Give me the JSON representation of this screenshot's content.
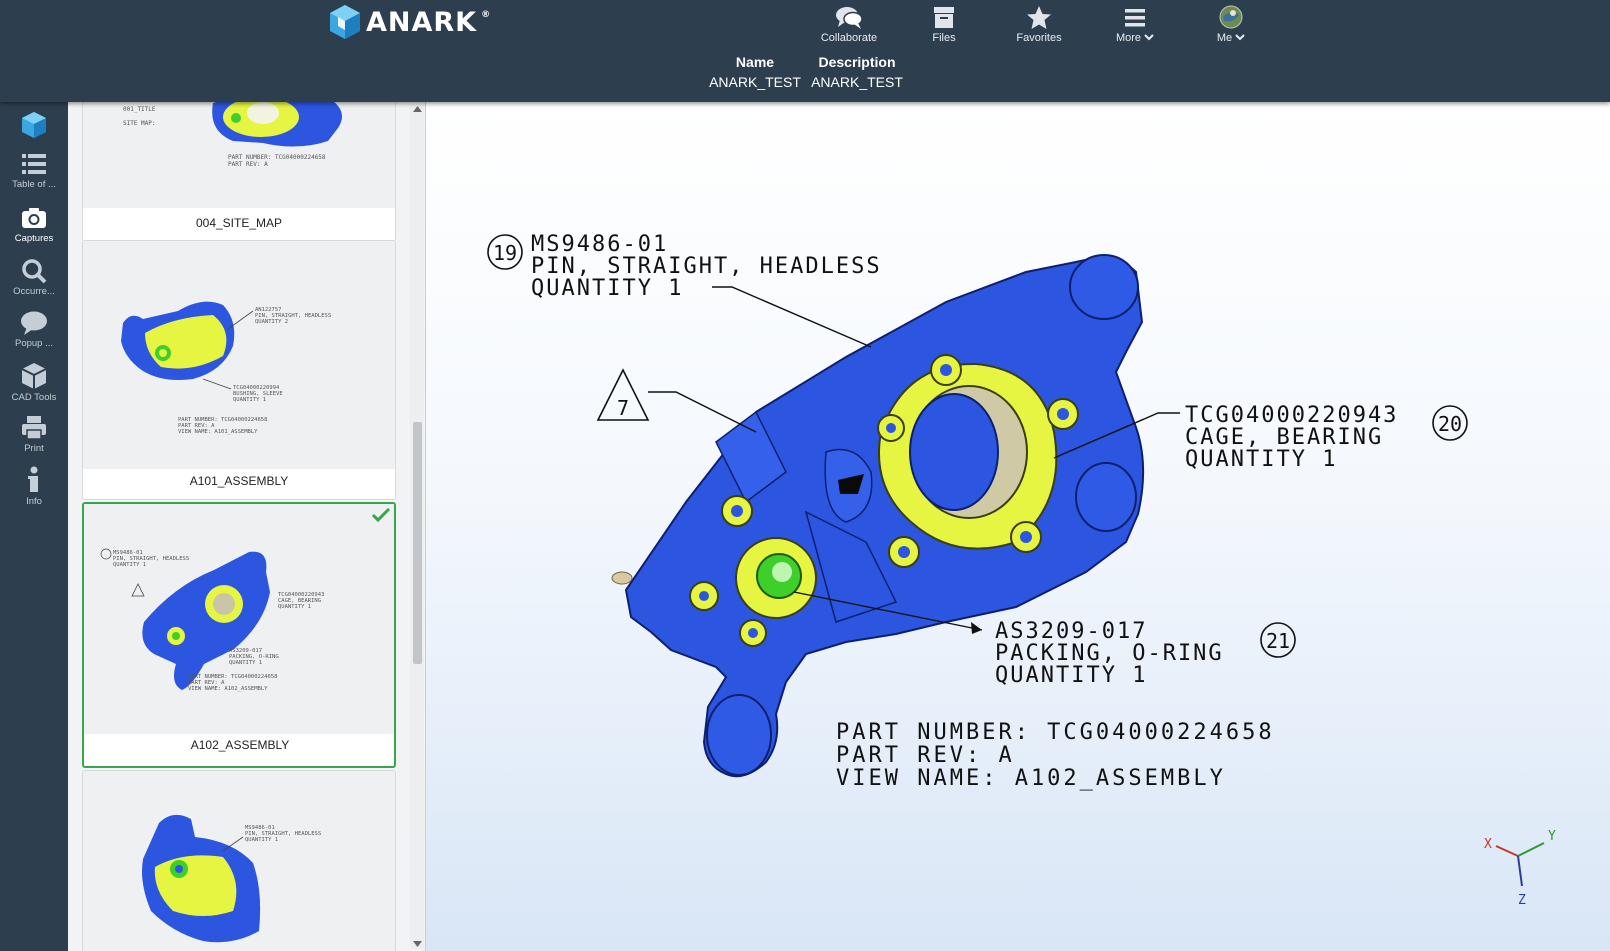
{
  "app": {
    "logo_text": "ANARK"
  },
  "nav": {
    "collaborate": "Collaborate",
    "files": "Files",
    "favorites": "Favorites",
    "more": "More",
    "me": "Me"
  },
  "doc_meta": {
    "name_header": "Name",
    "name_value": "ANARK_TEST",
    "description_header": "Description",
    "description_value": "ANARK_TEST"
  },
  "rail": {
    "table_of_contents": "Table of ...",
    "captures": "Captures",
    "occurrences": "Occurre...",
    "popup": "Popup ...",
    "cad_tools": "CAD Tools",
    "print": "Print",
    "info": "Info"
  },
  "captures": [
    {
      "label": "004_SITE_MAP",
      "selected": false
    },
    {
      "label": "A101_ASSEMBLY",
      "selected": false
    },
    {
      "label": "A102_ASSEMBLY",
      "selected": true
    },
    {
      "label": "",
      "selected": false
    }
  ],
  "thumb_text": {
    "site_title": "001_TITLE",
    "site_map": "SITE MAP:",
    "site_part_number": "PART NUMBER: TCG04000224658",
    "site_part_rev": "PART REV: A",
    "a101_callout1": "AN122757",
    "a101_callout1b": "PIN, STRAIGHT, HEADLESS",
    "a101_callout1c": "QUANTITY 2",
    "a101_callout2": "TCG04000220994",
    "a101_callout2b": "BUSHING, SLEEVE",
    "a101_callout2c": "QUANTITY 1",
    "a101_part_number": "PART NUMBER: TCG04000224658",
    "a101_part_rev": "PART REV: A",
    "a101_view_name": "VIEW NAME: A101_ASSEMBLY",
    "a102_callout1": "MS9486-01",
    "a102_callout1b": "PIN, STRAIGHT, HEADLESS",
    "a102_callout1c": "QUANTITY 1",
    "a102_callout2": "TCG04000220943",
    "a102_callout2b": "CAGE, BEARING",
    "a102_callout2c": "QUANTITY 1",
    "a102_callout3": "AS3209-017",
    "a102_callout3b": "PACKING, O-RING",
    "a102_callout3c": "QUANTITY 1",
    "a102_part_number": "PART NUMBER: TCG04000224658",
    "a102_part_rev": "PART REV: A",
    "a102_view_name": "VIEW NAME: A102_ASSEMBLY",
    "t4_callout1": "MS9486-01",
    "t4_callout1b": "PIN, STRAIGHT, HEADLESS",
    "t4_callout1c": "QUANTITY 1"
  },
  "drawing": {
    "callout_19_balloon": "19",
    "callout_19_line1": "MS9486-01",
    "callout_19_line2": "PIN, STRAIGHT, HEADLESS",
    "callout_19_line3": "QUANTITY 1",
    "flag_7": "7",
    "callout_20_balloon": "20",
    "callout_20_line1": "TCG04000220943",
    "callout_20_line2": "CAGE, BEARING",
    "callout_20_line3": "QUANTITY 1",
    "callout_21_balloon": "21",
    "callout_21_line1": "AS3209-017",
    "callout_21_line2": "PACKING, O-RING",
    "callout_21_line3": "QUANTITY 1",
    "part_number": "PART NUMBER: TCG04000224658",
    "part_rev": "PART REV: A",
    "view_name": "VIEW NAME: A102_ASSEMBLY"
  },
  "axes": {
    "x": "X",
    "y": "Y",
    "z": "Z"
  },
  "colors": {
    "chrome": "#2d3f4f",
    "part_blue": "#2c56e0",
    "part_yellow": "#e6f542",
    "part_green": "#3fcf2a",
    "selection_green": "#38a64b"
  }
}
